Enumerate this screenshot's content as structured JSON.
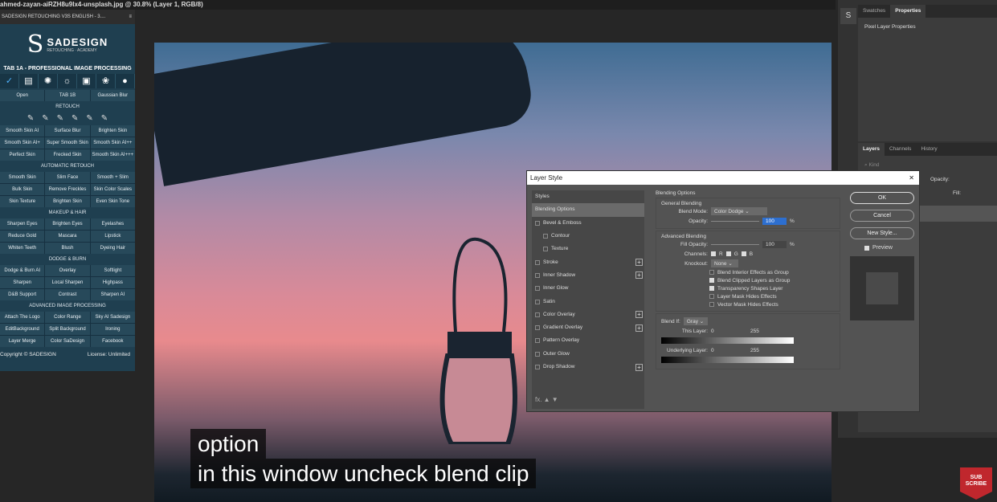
{
  "title": "ahmed-zayan-aiRZH8u9Ix4-unsplash.jpg @ 30.8% (Layer 1, RGB/8)",
  "plugin": {
    "header": "SADESIGN RETOUCHING V3S ENGLISH - 3....",
    "logo_main": "SADESIGN",
    "logo_sub": "RETOUCHING · ACADEMY",
    "tab_title": "TAB 1A - PROFESSIONAL IMAGE PROCESSING",
    "top_row": [
      "Open",
      "TAB 1B",
      "Gaussian Blur"
    ],
    "sections": [
      {
        "title": "RETOUCH",
        "buttons": [
          "Smooth Skin AI",
          "Surface Blur",
          "Brighten Skin",
          "Smooth Skin AI+",
          "Super Smooth Skin",
          "Smooth Skin AI++",
          "Perfect Skin",
          "Frecked Skin",
          "Smooth Skin AI+++"
        ]
      },
      {
        "title": "AUTOMATIC RETOUCH",
        "buttons": [
          "Smooth Skin",
          "Slim Face",
          "Smooth + Slim",
          "Bulk Skin",
          "Remove Freckles",
          "Skin Color Scales",
          "Skin Texture",
          "Brighten Skin",
          "Even Skin Tone"
        ]
      },
      {
        "title": "MAKEUP & HAIR",
        "buttons": [
          "Sharpen Eyes",
          "Brighten Eyes",
          "Eyelashes",
          "Reduce Gold",
          "Mascara",
          "Lipstick",
          "Whiten Teeth",
          "Blush",
          "Dyeing Hair"
        ]
      },
      {
        "title": "DODGE & BURN",
        "buttons": [
          "Dodge & Burn AI",
          "Overlay",
          "Softlight",
          "Sharpen",
          "Local Sharpen",
          "Highpass",
          "D&B Support",
          "Contrast",
          "Sharpen AI"
        ]
      },
      {
        "title": "ADVANCED IMAGE PROCESSING",
        "buttons": [
          "Attach The Logo",
          "Color Range",
          "Sky AI Sadesign",
          "EditBackground",
          "Split Background",
          "Ironing",
          "Layer Merge",
          "Color SaDesign",
          "Facebook"
        ]
      }
    ],
    "copyright": "Copyright © SADESIGN",
    "license": "License: Unlimited"
  },
  "subtitle": [
    "option",
    "in this window uncheck blend clip"
  ],
  "dialog": {
    "title": "Layer Style",
    "styles": [
      {
        "label": "Styles",
        "cb": null
      },
      {
        "label": "Blending Options",
        "cb": null,
        "active": true
      },
      {
        "label": "Bevel & Emboss",
        "cb": false
      },
      {
        "label": "Contour",
        "cb": false,
        "indent": true
      },
      {
        "label": "Texture",
        "cb": false,
        "indent": true
      },
      {
        "label": "Stroke",
        "cb": false,
        "plus": true
      },
      {
        "label": "Inner Shadow",
        "cb": false,
        "plus": true
      },
      {
        "label": "Inner Glow",
        "cb": false
      },
      {
        "label": "Satin",
        "cb": false
      },
      {
        "label": "Color Overlay",
        "cb": false,
        "plus": true
      },
      {
        "label": "Gradient Overlay",
        "cb": false,
        "plus": true
      },
      {
        "label": "Pattern Overlay",
        "cb": false
      },
      {
        "label": "Outer Glow",
        "cb": false
      },
      {
        "label": "Drop Shadow",
        "cb": false,
        "plus": true
      }
    ],
    "blending_options": "Blending Options",
    "general": "General Blending",
    "blend_mode_label": "Blend Mode:",
    "blend_mode": "Color Dodge",
    "opacity_label": "Opacity:",
    "opacity": "100",
    "pct": "%",
    "advanced": "Advanced Blending",
    "fill_label": "Fill Opacity:",
    "fill": "100",
    "channels_label": "Channels:",
    "ch_r": "R",
    "ch_g": "G",
    "ch_b": "B",
    "knockout_label": "Knockout:",
    "knockout": "None",
    "checks": [
      {
        "label": "Blend Interior Effects as Group",
        "on": false
      },
      {
        "label": "Blend Clipped Layers as Group",
        "on": true
      },
      {
        "label": "Transparency Shapes Layer",
        "on": true
      },
      {
        "label": "Layer Mask Hides Effects",
        "on": false
      },
      {
        "label": "Vector Mask Hides Effects",
        "on": false
      }
    ],
    "blend_if_label": "Blend If:",
    "blend_if": "Gray",
    "this_layer": "This Layer:",
    "underlying": "Underlying Layer:",
    "min": "0",
    "max": "255",
    "ok": "OK",
    "cancel": "Cancel",
    "new_style": "New Style...",
    "preview": "Preview"
  },
  "right": {
    "tabs": [
      "Swatches",
      "Properties"
    ],
    "props_title": "Pixel Layer Properties",
    "layer_tabs": [
      "Layers",
      "Channels",
      "History"
    ],
    "kind": "Kind",
    "opacity_label": "Opacity:",
    "fill_label": "Fill:"
  },
  "subscribe": "SUB SCRIBE"
}
